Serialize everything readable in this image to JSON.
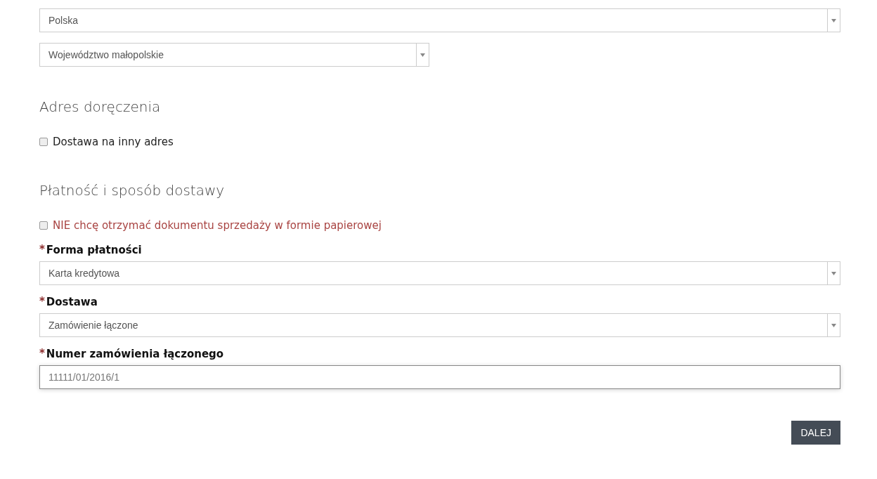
{
  "region_selects": [
    {
      "value": "Polska"
    },
    {
      "value": "Województwo małopolskie"
    }
  ],
  "sections": [
    {
      "heading": "Adres doręczenia",
      "checkbox": {
        "label": "Dostawa na inny adres",
        "checked": false,
        "kind": "plain"
      }
    },
    {
      "heading": "Płatność i sposób dostawy",
      "checkbox": {
        "label": "NIE chcę otrzymać dokumentu sprzedaży w formie papierowej",
        "checked": false,
        "kind": "notice"
      },
      "fields": [
        {
          "kind": "select",
          "required_mark": "*",
          "label": "Forma płatności",
          "value": "Karta kredytowa"
        },
        {
          "kind": "select",
          "required_mark": "*",
          "label": "Dostawa",
          "value": "Zamówienie łączone"
        },
        {
          "kind": "input",
          "required_mark": "*",
          "label": "Numer zamówienia łączonego",
          "value": "11111/01/2016/1",
          "focused": true
        }
      ]
    }
  ],
  "submit_button": "DALEJ"
}
